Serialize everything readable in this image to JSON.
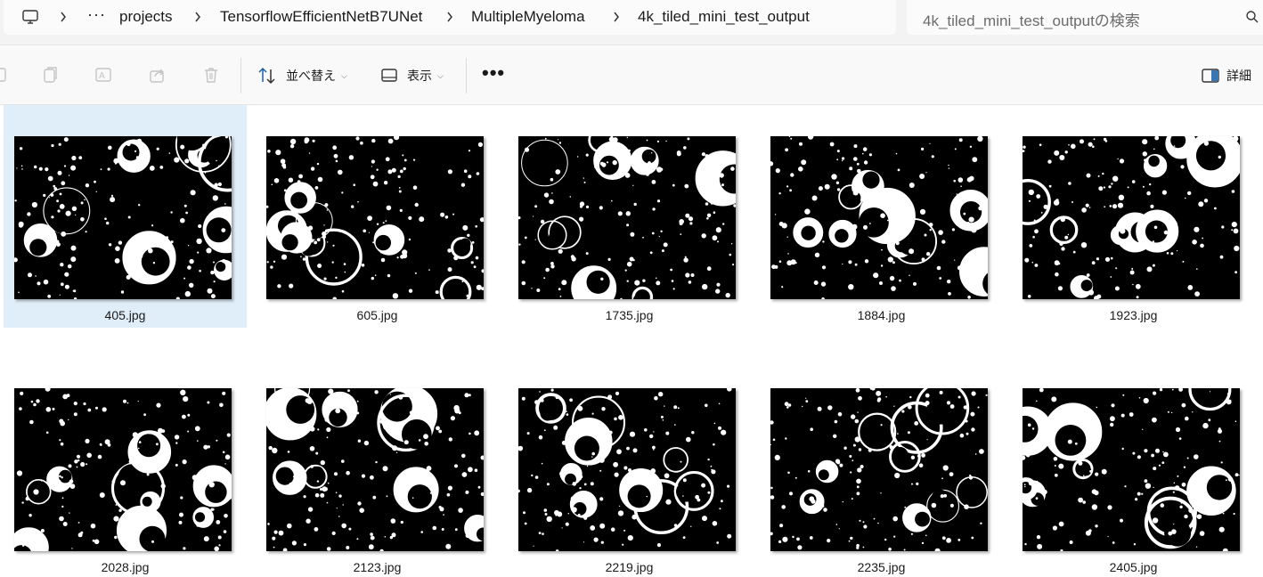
{
  "address_bar": {
    "crumbs": [
      "projects",
      "TensorflowEfficientNetB7UNet",
      "MultipleMyeloma",
      "4k_tiled_mini_test_output"
    ],
    "overflow": "···"
  },
  "search": {
    "placeholder": "4k_tiled_mini_test_outputの検索"
  },
  "toolbar": {
    "sort_label": "並べ替え",
    "view_label": "表示",
    "more_label": "•••",
    "details_label": "詳細"
  },
  "files": [
    {
      "name": "405.jpg",
      "selected": true
    },
    {
      "name": "605.jpg",
      "selected": false
    },
    {
      "name": "1735.jpg",
      "selected": false
    },
    {
      "name": "1884.jpg",
      "selected": false
    },
    {
      "name": "1923.jpg",
      "selected": false
    },
    {
      "name": "2028.jpg",
      "selected": false
    },
    {
      "name": "2123.jpg",
      "selected": false
    },
    {
      "name": "2219.jpg",
      "selected": false
    },
    {
      "name": "2235.jpg",
      "selected": false
    },
    {
      "name": "2405.jpg",
      "selected": false
    }
  ],
  "colors": {
    "selection": "#e0eef9",
    "accent": "#005fb8"
  }
}
